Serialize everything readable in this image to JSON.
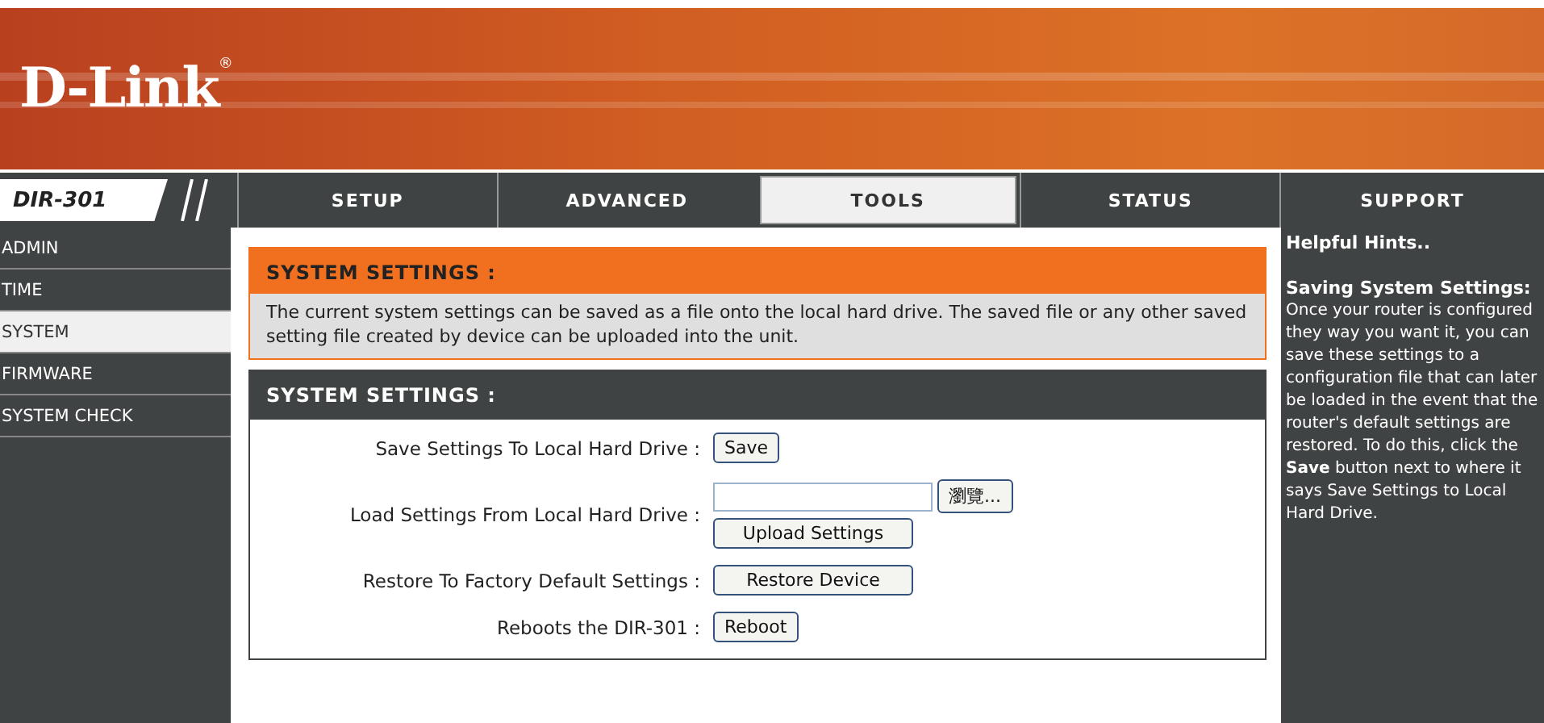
{
  "header": {
    "logo": "D-Link",
    "trademark": "®"
  },
  "model": "DIR-301",
  "tabs": [
    {
      "label": "SETUP",
      "selected": false
    },
    {
      "label": "ADVANCED",
      "selected": false
    },
    {
      "label": "TOOLS",
      "selected": true
    },
    {
      "label": "STATUS",
      "selected": false
    },
    {
      "label": "SUPPORT",
      "selected": false
    }
  ],
  "sidebar": {
    "items": [
      {
        "label": "ADMIN",
        "selected": false
      },
      {
        "label": "TIME",
        "selected": false
      },
      {
        "label": "SYSTEM",
        "selected": true
      },
      {
        "label": "FIRMWARE",
        "selected": false
      },
      {
        "label": "SYSTEM CHECK",
        "selected": false
      }
    ]
  },
  "intro": {
    "title": "SYSTEM SETTINGS :",
    "text": "The current system settings can be saved as a file onto the local hard drive. The saved file or any other saved setting file created by device can be uploaded into the unit."
  },
  "settings": {
    "title": "SYSTEM SETTINGS :",
    "rows": [
      {
        "kind": "button",
        "label": "Save Settings To Local Hard Drive :",
        "button": "Save"
      },
      {
        "kind": "file",
        "label": "Load Settings From Local Hard Drive :",
        "browse": "瀏覽...",
        "button": "Upload Settings"
      },
      {
        "kind": "button",
        "label": "Restore To Factory Default Settings :",
        "button": "Restore Device"
      },
      {
        "kind": "button",
        "label": "Reboots the DIR-301 :",
        "button": "Reboot"
      }
    ]
  },
  "hints": {
    "title": "Helpful Hints..",
    "subtitle": "Saving System Settings:",
    "text": "Once your router is configured they way you want it, you can save these settings to a configuration file that can later be loaded in the event that the router's default settings are restored. To do this, click the **Save** button next to where it says Save Settings to Local Hard Drive."
  }
}
